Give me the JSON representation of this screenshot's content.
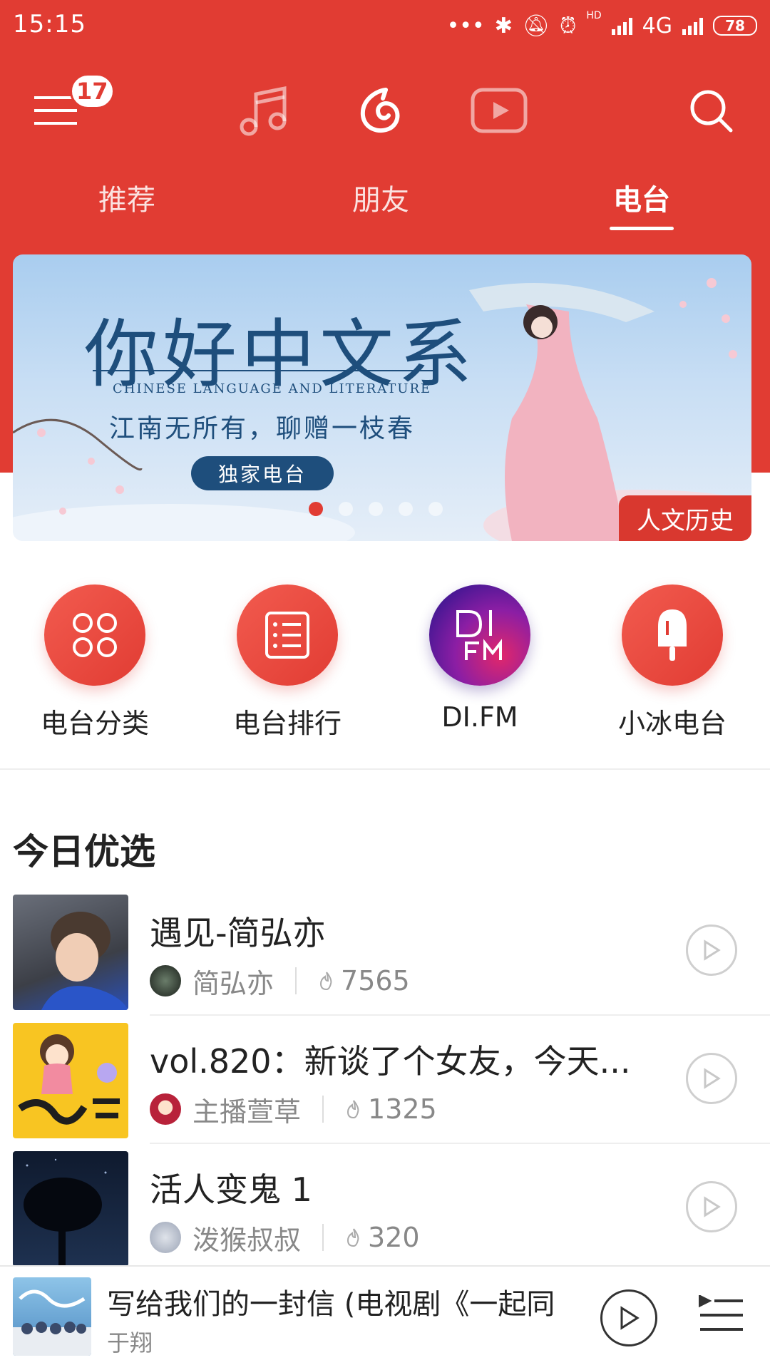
{
  "status": {
    "time": "15:15",
    "network": "4G",
    "hd": "HD",
    "battery": "78"
  },
  "nav": {
    "menu_badge": "17"
  },
  "tabs": [
    "推荐",
    "朋友",
    "电台"
  ],
  "banner": {
    "title": "你好中文系",
    "english": "CHINESE LANGUAGE AND LITERATURE",
    "subtitle": "江南无所有，聊赠一枝春",
    "pill": "独家电台",
    "tag": "人文历史"
  },
  "quick_actions": [
    {
      "label": "电台分类",
      "icon": "grid-icon"
    },
    {
      "label": "电台排行",
      "icon": "list-icon"
    },
    {
      "label": "DI.FM",
      "icon": "difm-logo"
    },
    {
      "label": "小冰电台",
      "icon": "popsicle-icon"
    }
  ],
  "section": {
    "title": "今日优选"
  },
  "items": [
    {
      "title": "遇见-简弘亦",
      "host": "简弘亦",
      "count": "7565"
    },
    {
      "title": "vol.820：新谈了个女友，今天...",
      "host": "主播萱草",
      "count": "1325"
    },
    {
      "title": "活人变鬼 1",
      "host": "泼猴叔叔",
      "count": "320"
    }
  ],
  "player": {
    "title": "写给我们的一封信 (电视剧《一起同",
    "artist": "于翔"
  },
  "colors": {
    "brand": "#e13c33"
  }
}
